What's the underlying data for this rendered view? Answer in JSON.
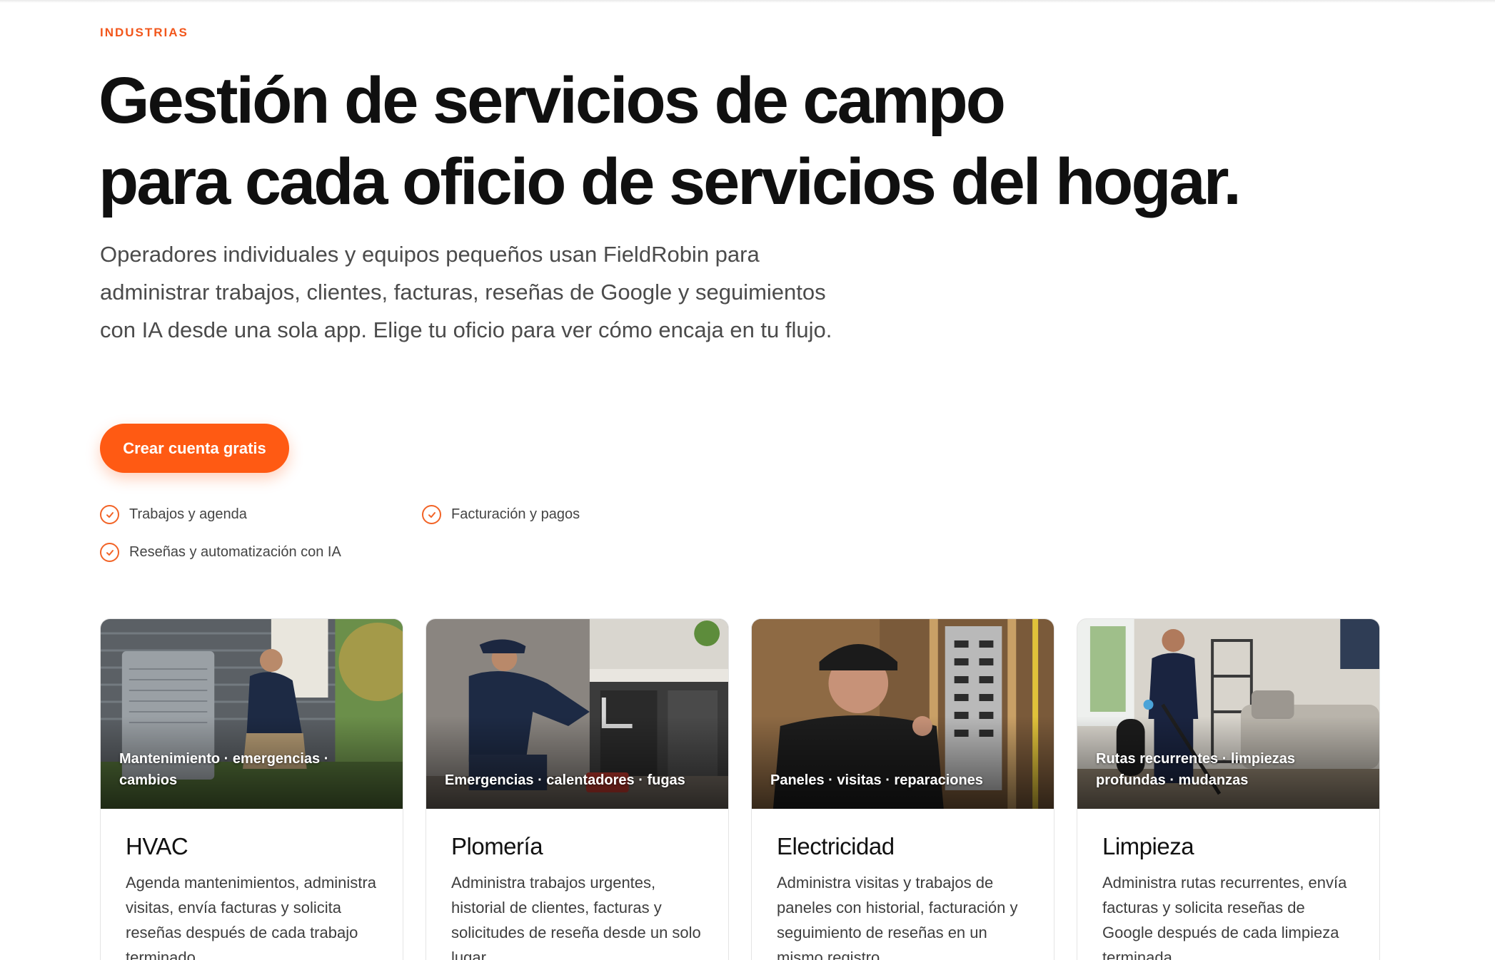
{
  "section": {
    "eyebrow": "INDUSTRIAS",
    "headline_line1": "Gestión de servicios de campo",
    "headline_line2": "para cada oficio de servicios del hogar.",
    "lead": "Operadores individuales y equipos pequeños usan FieldRobin para administrar trabajos, clientes, facturas, reseñas de Google y seguimientos con IA desde una sola app. Elige tu oficio para ver cómo encaja en tu flujo."
  },
  "cta": {
    "label": "Crear cuenta gratis"
  },
  "features": [
    {
      "label": "Trabajos y agenda"
    },
    {
      "label": "Facturación y pagos"
    },
    {
      "label": "Reseñas y automatización con IA"
    }
  ],
  "cards": [
    {
      "tags": "Mantenimiento · emergencias · cambios",
      "title": "HVAC",
      "description": "Agenda mantenimientos, administra visitas, envía facturas y solicita reseñas después de cada trabajo terminado."
    },
    {
      "tags": "Emergencias · calentadores · fugas",
      "title": "Plomería",
      "description": "Administra trabajos urgentes, historial de clientes, facturas y solicitudes de reseña desde un solo lugar."
    },
    {
      "tags": "Paneles · visitas · reparaciones",
      "title": "Electricidad",
      "description": "Administra visitas y trabajos de paneles con historial, facturación y seguimiento de reseñas en un mismo registro."
    },
    {
      "tags": "Rutas recurrentes · limpiezas profundas · mudanzas",
      "title": "Limpieza",
      "description": "Administra rutas recurrentes, envía facturas y solicita reseñas de Google después de cada limpieza terminada."
    }
  ],
  "theme": {
    "accent": "#ff5a13",
    "text": "#111111",
    "muted": "#4b4b4b"
  },
  "icons": {
    "feature": "check-circle-icon"
  }
}
